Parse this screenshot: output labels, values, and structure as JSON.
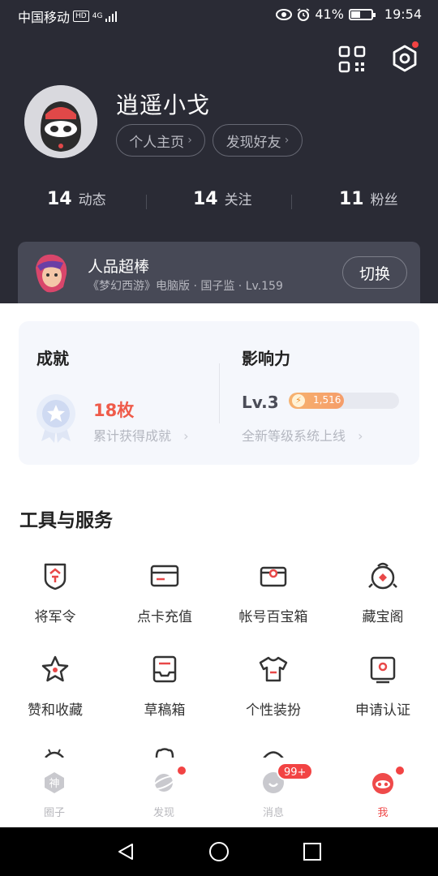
{
  "status_bar": {
    "carrier": "中国移动",
    "network_badge": "HD",
    "network_type": "4G",
    "battery": "41%",
    "time": "19:54"
  },
  "header": {
    "qr_icon": "qr-code-icon",
    "settings_icon": "settings-icon"
  },
  "profile": {
    "username": "逍遥小戈",
    "homepage_button": "个人主页",
    "find_friends_button": "发现好友"
  },
  "stats": [
    {
      "count": "14",
      "label": "动态"
    },
    {
      "count": "14",
      "label": "关注"
    },
    {
      "count": "11",
      "label": "粉丝"
    }
  ],
  "game_role": {
    "title": "人品超棒",
    "subtitle": "《梦幻西游》电脑版 · 国子监 · Lv.159",
    "switch_button": "切换"
  },
  "achievement": {
    "heading": "成就",
    "count": "18枚",
    "description": "累计获得成就"
  },
  "influence": {
    "heading": "影响力",
    "level": "Lv.3",
    "points": "1,516",
    "progress_fraction": 0.5,
    "description": "全新等级系统上线"
  },
  "tools": {
    "title": "工具与服务",
    "items": [
      {
        "label": "将军令",
        "icon": "token-shield-icon"
      },
      {
        "label": "点卡充值",
        "icon": "card-icon"
      },
      {
        "label": "帐号百宝箱",
        "icon": "treasure-box-icon"
      },
      {
        "label": "藏宝阁",
        "icon": "treasure-pavilion-icon"
      },
      {
        "label": "赞和收藏",
        "icon": "star-icon"
      },
      {
        "label": "草稿箱",
        "icon": "drafts-icon"
      },
      {
        "label": "个性装扮",
        "icon": "tshirt-icon"
      },
      {
        "label": "申请认证",
        "icon": "certification-icon"
      }
    ]
  },
  "tabbar": {
    "tabs": [
      {
        "label": "圈子",
        "icon": "circle-god-icon"
      },
      {
        "label": "发现",
        "icon": "planet-icon"
      },
      {
        "label": "消息",
        "icon": "message-icon"
      },
      {
        "label": "我",
        "icon": "me-icon"
      }
    ],
    "message_badge": "99+"
  },
  "colors": {
    "header_bg": "#2a2b35",
    "accent_red": "#ef5b4a",
    "badge_red": "#f24343"
  }
}
